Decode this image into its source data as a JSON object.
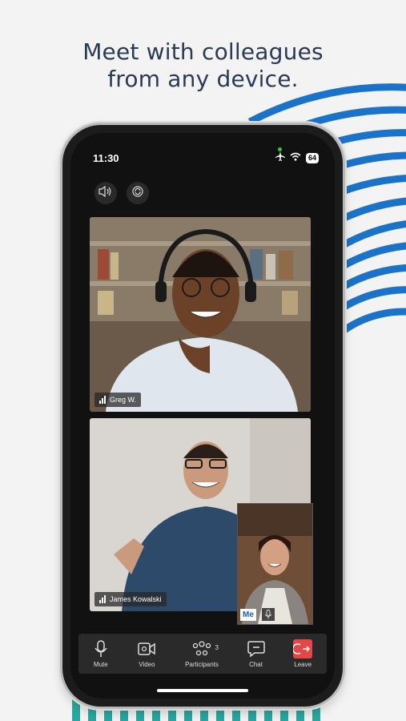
{
  "headline": {
    "line1": "Meet with colleagues",
    "line2": "from any device."
  },
  "status": {
    "time": "11:30",
    "battery": "64"
  },
  "top_controls": {
    "speaker_icon": "speaker-icon",
    "camera_switch_icon": "camera-switch-icon"
  },
  "participants_tiles": [
    {
      "name": "Greg W."
    },
    {
      "name": "James Kowalski"
    }
  ],
  "self_view": {
    "label": "Me"
  },
  "toolbar": {
    "mute_label": "Mute",
    "video_label": "Video",
    "participants_label": "Participants",
    "participants_count": "3",
    "chat_label": "Chat",
    "leave_label": "Leave"
  },
  "colors": {
    "accent_blue": "#1a73c8",
    "teal": "#2aa7a0",
    "leave_red": "#e54747",
    "headline": "#2b3a55"
  }
}
